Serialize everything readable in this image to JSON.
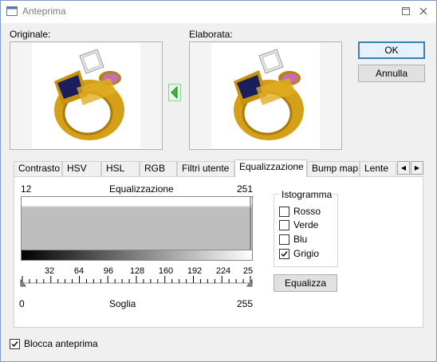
{
  "window": {
    "title": "Anteprima"
  },
  "labels": {
    "original": "Originale:",
    "processed": "Elaborata:"
  },
  "buttons": {
    "ok": "OK",
    "cancel": "Annulla",
    "equalize": "Equalizza"
  },
  "tabs": [
    "Contrasto",
    "HSV",
    "HSL",
    "RGB",
    "Filtri utente",
    "Equalizzazione",
    "Bump map",
    "Lente"
  ],
  "active_tab": "Equalizzazione",
  "equalization": {
    "label": "Equalizzazione",
    "min_value": "12",
    "max_value": "251",
    "threshold_label": "Soglia",
    "threshold_min": "0",
    "threshold_max": "255",
    "scale_ticks": [
      "32",
      "64",
      "96",
      "128",
      "160",
      "192",
      "224",
      "25"
    ]
  },
  "histogram_group": {
    "title": "Istogramma",
    "channels": [
      {
        "label": "Rosso",
        "checked": false
      },
      {
        "label": "Verde",
        "checked": false
      },
      {
        "label": "Blu",
        "checked": false
      },
      {
        "label": "Grigio",
        "checked": true
      }
    ]
  },
  "lock_preview": {
    "label": "Blocca anteprima",
    "checked": true
  },
  "colors": {
    "accent": "#3c7fb1",
    "arrow": "#38b838",
    "gold": "#d4a017",
    "gem_blue": "#1a1f5c",
    "gem_pink": "#c86bb0"
  },
  "icons": {
    "window": "app-window-icon",
    "minimize": "minimize-icon",
    "close": "close-icon",
    "copy": "green-arrow-left-icon"
  }
}
